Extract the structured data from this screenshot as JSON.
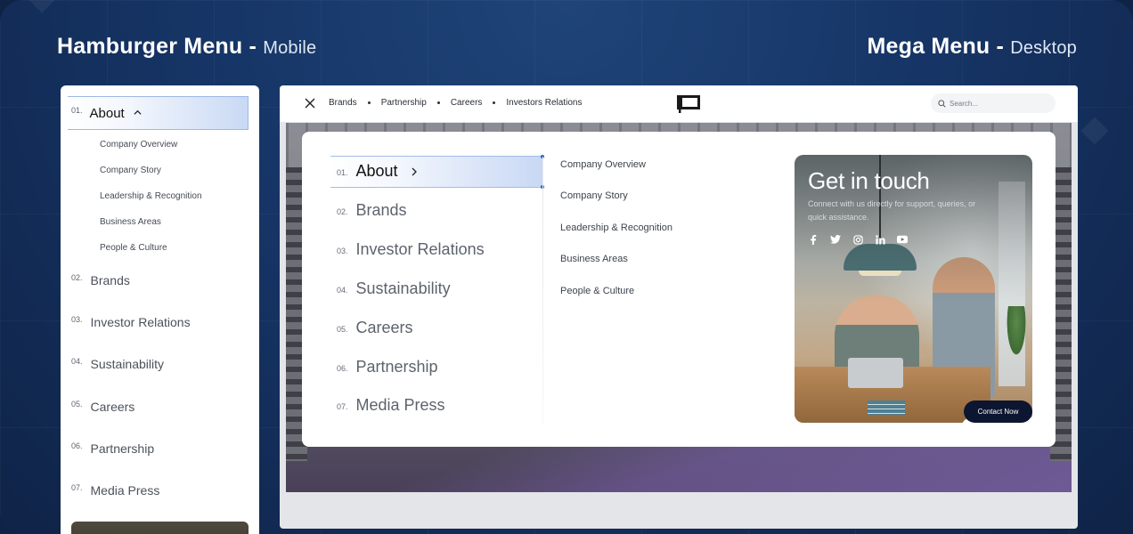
{
  "headings": {
    "left_title": "Hamburger Menu -",
    "left_sub": "Mobile",
    "right_title": "Mega Menu -",
    "right_sub": "Desktop"
  },
  "mobile": {
    "active": {
      "num": "01.",
      "label": "About"
    },
    "submenu": [
      "Company Overview",
      "Company Story",
      "Leadership & Recognition",
      "Business Areas",
      "People & Culture"
    ],
    "items": [
      {
        "num": "02.",
        "label": "Brands"
      },
      {
        "num": "03.",
        "label": "Investor Relations"
      },
      {
        "num": "04.",
        "label": "Sustainability"
      },
      {
        "num": "05.",
        "label": "Careers"
      },
      {
        "num": "06.",
        "label": "Partnership"
      },
      {
        "num": "07.",
        "label": "Media Press"
      }
    ]
  },
  "desktop": {
    "nav_links": [
      "Brands",
      "Partnership",
      "Careers",
      "Investors Relations"
    ],
    "search_placeholder": "Search...",
    "menu": [
      {
        "num": "01.",
        "label": "About"
      },
      {
        "num": "02.",
        "label": "Brands"
      },
      {
        "num": "03.",
        "label": "Investor Relations"
      },
      {
        "num": "04.",
        "label": "Sustainability"
      },
      {
        "num": "05.",
        "label": "Careers"
      },
      {
        "num": "06.",
        "label": "Partnership"
      },
      {
        "num": "07.",
        "label": "Media Press"
      }
    ],
    "submenu": [
      "Company Overview",
      "Company Story",
      "Leadership & Recognition",
      "Business Areas",
      "People & Culture"
    ],
    "touch": {
      "title": "Get in touch",
      "description": "Connect with us directly for support, queries, or quick assistance.",
      "socials": [
        "facebook-icon",
        "twitter-icon",
        "instagram-icon",
        "linkedin-icon",
        "youtube-icon"
      ],
      "button": "Contact Now"
    }
  },
  "colors": {
    "background": "#163566",
    "active_gradient": "#c8d8f4",
    "active_border": "#a2bce8",
    "button": "#0c1630"
  }
}
